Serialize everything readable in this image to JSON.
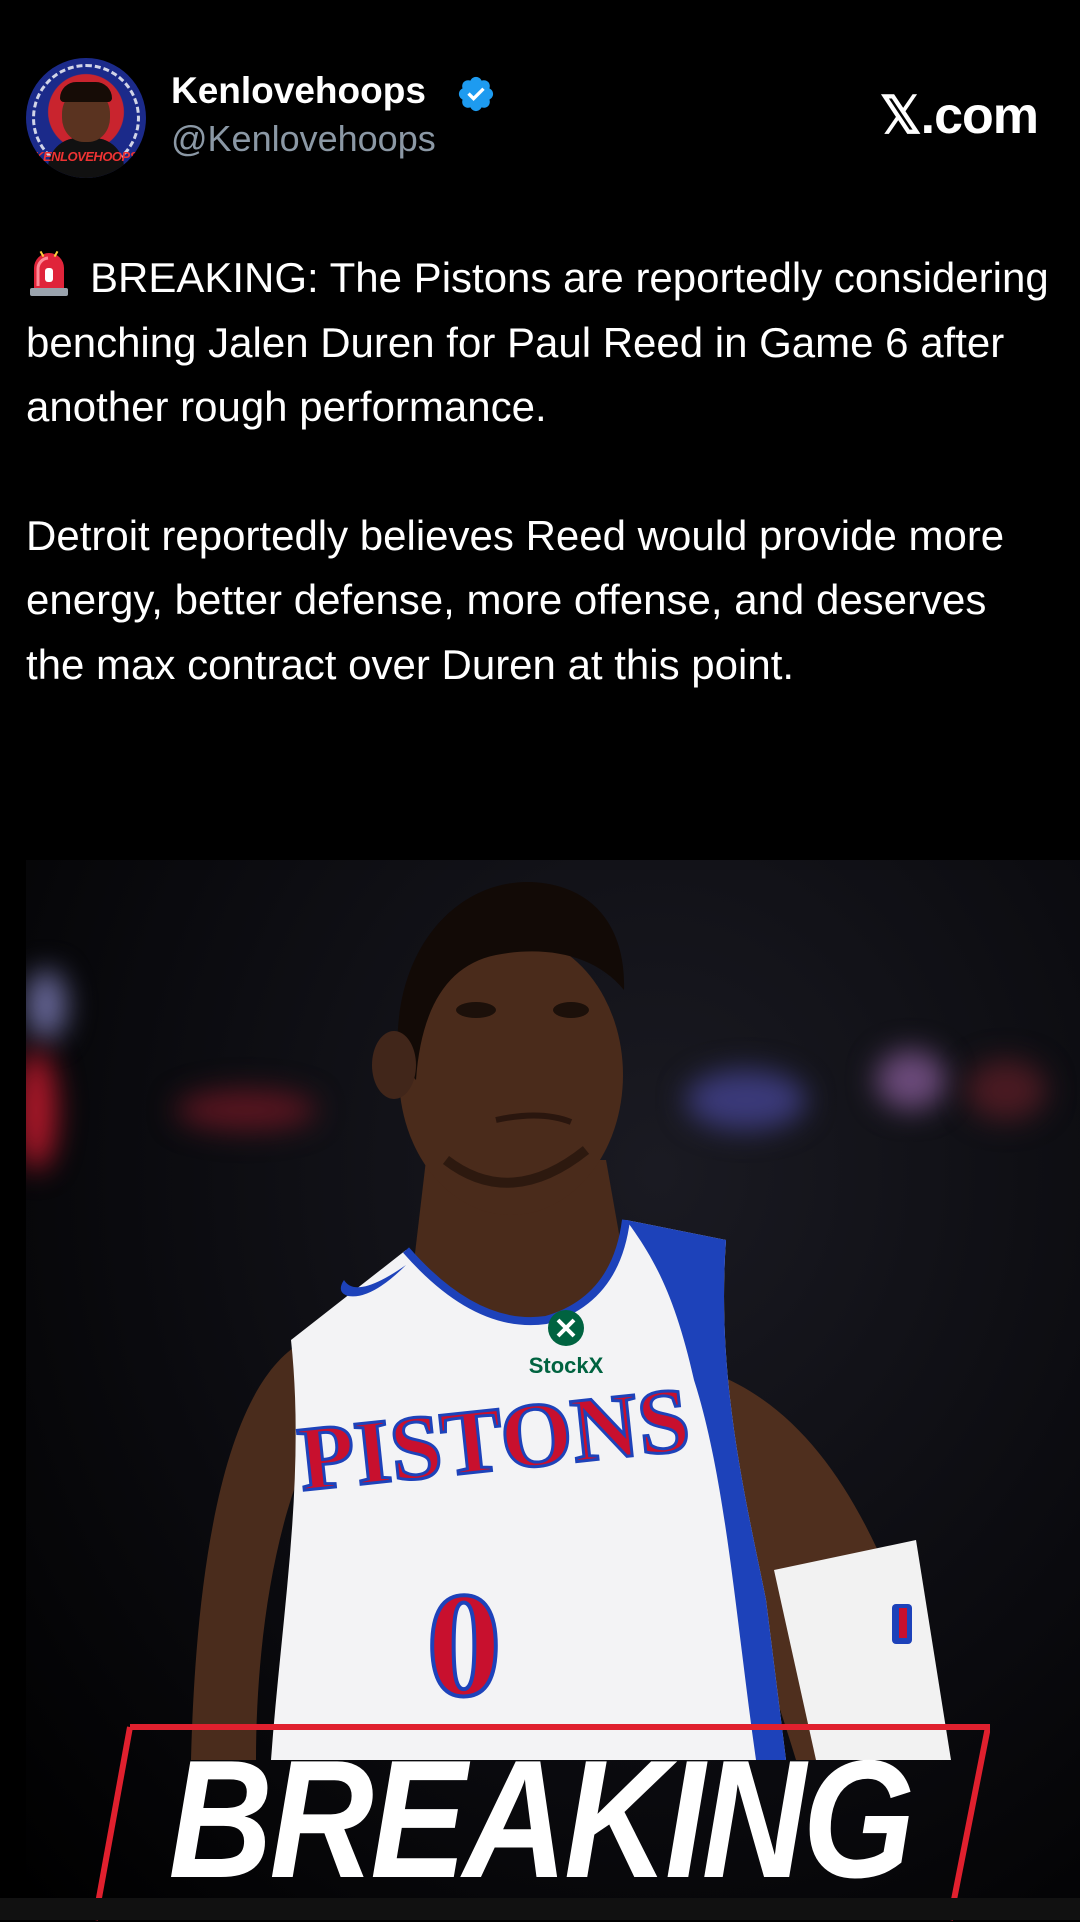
{
  "author": {
    "display_name": "Kenlovehoops",
    "handle": "@Kenlovehoops",
    "avatar_text": "KENLOVEHOOPS",
    "verified": true
  },
  "site_badge": "𝕏.com",
  "tweet": {
    "emoji": "rotating-light-icon",
    "paragraph_1": "BREAKING: The Pistons are reportedly considering benching Jalen Duren for Paul Reed in Game 6 after another rough performance.",
    "paragraph_2": "Detroit reportedly believes Reed would provide more energy, better defense, more offense, and deserves the max contract over Duren at this point."
  },
  "image": {
    "jersey_team": "PISTONS",
    "jersey_number": "0",
    "sponsor": "StockX",
    "banner_text": "BREAKING"
  },
  "colors": {
    "background": "#000000",
    "verified_blue": "#1d9bf0",
    "handle_gray": "#8b98a5",
    "pistons_red": "#c8102e",
    "pistons_blue": "#1d42ba",
    "stockx_green": "#006340"
  }
}
